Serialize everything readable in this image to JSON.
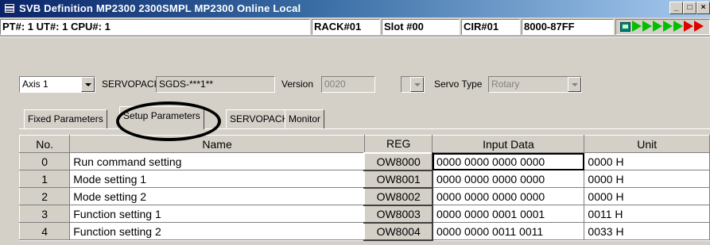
{
  "window": {
    "title": "SVB Definition   MP2300  2300SMPL  MP2300   Online  Local",
    "minimize": "_",
    "maximize": "□",
    "close": "×"
  },
  "infobar": {
    "pt_ut_cpu": "PT#: 1 UT#: 1 CPU#: 1",
    "rack": "RACK#01",
    "slot": "Slot #00",
    "cir": "CIR#01",
    "address": "8000-87FF"
  },
  "axis": {
    "selected": "Axis 1",
    "servopack_label": "SERVOPACK",
    "servopack_model": "SGDS-***1**",
    "version_label": "Version",
    "version_value": "0020",
    "servo_type_label": "Servo Type",
    "servo_type_value": "Rotary"
  },
  "tabs": [
    {
      "label": "Fixed Parameters",
      "active": false
    },
    {
      "label": "Setup Parameters",
      "active": true
    },
    {
      "label": "SERVOPACK",
      "active": false
    },
    {
      "label": "Monitor",
      "active": false
    }
  ],
  "table": {
    "headers": [
      "No.",
      "Name",
      "REG",
      "Input Data",
      "Unit"
    ],
    "rows": [
      {
        "no": "0",
        "name": "Run command setting",
        "reg": "OW8000",
        "input": "0000 0000 0000 0000",
        "unit": "0000 H"
      },
      {
        "no": "1",
        "name": "Mode setting 1",
        "reg": "OW8001",
        "input": "0000 0000 0000 0000",
        "unit": "0000 H"
      },
      {
        "no": "2",
        "name": "Mode setting 2",
        "reg": "OW8002",
        "input": "0000 0000 0000 0000",
        "unit": "0000 H"
      },
      {
        "no": "3",
        "name": "Function setting 1",
        "reg": "OW8003",
        "input": "0000 0000 0001 0001",
        "unit": "0011 H"
      },
      {
        "no": "4",
        "name": "Function setting 2",
        "reg": "OW8004",
        "input": "0000 0000 0011 0011",
        "unit": "0033 H"
      }
    ]
  },
  "colors": {
    "titlebar_start": "#0a246a",
    "panel": "#d4d0c8",
    "status_green": "#00c000",
    "status_red": "#e00000"
  }
}
